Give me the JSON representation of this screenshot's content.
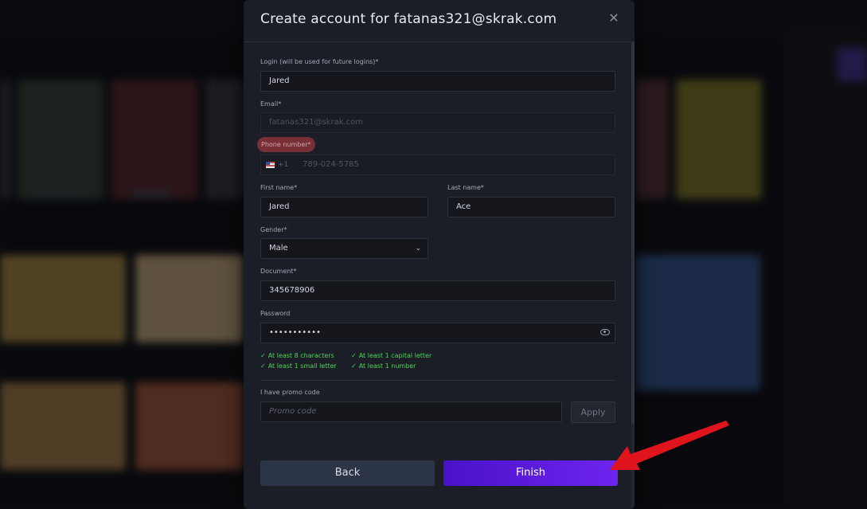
{
  "modal": {
    "title": "Create account for fatanas321@skrak.com",
    "close_icon": "close-icon"
  },
  "form": {
    "login": {
      "label": "Login (will be used for future logins)*",
      "value": "Jared"
    },
    "email": {
      "label": "Email*",
      "value": "fatanas321@skrak.com"
    },
    "phone": {
      "label": "Phone number*",
      "country_code": "+1",
      "placeholder": "789-024-5785",
      "flag_icon": "us-flag-icon"
    },
    "first_name": {
      "label": "First name*",
      "value": "Jared"
    },
    "last_name": {
      "label": "Last name*",
      "value": "Ace"
    },
    "gender": {
      "label": "Gender*",
      "value": "Male",
      "icon": "chevron-down-icon"
    },
    "document": {
      "label": "Document*",
      "value": "345678906"
    },
    "password": {
      "label": "Password",
      "value": "•••••••••••",
      "icon": "eye-icon"
    },
    "requirements": [
      {
        "text": "At least 8 characters"
      },
      {
        "text": "At least 1 capital letter"
      },
      {
        "text": "At least 1 small letter"
      },
      {
        "text": "At least 1 number"
      }
    ],
    "requirement_check": "✓",
    "promo": {
      "label": "I have promo code",
      "placeholder": "Promo code",
      "apply_label": "Apply"
    }
  },
  "actions": {
    "back_label": "Back",
    "finish_label": "Finish"
  },
  "colors": {
    "accent": "#5b1be0",
    "error_label_bg": "#7a2f37",
    "success_text": "#4fd15b",
    "annotation_arrow": "#e0141c"
  }
}
